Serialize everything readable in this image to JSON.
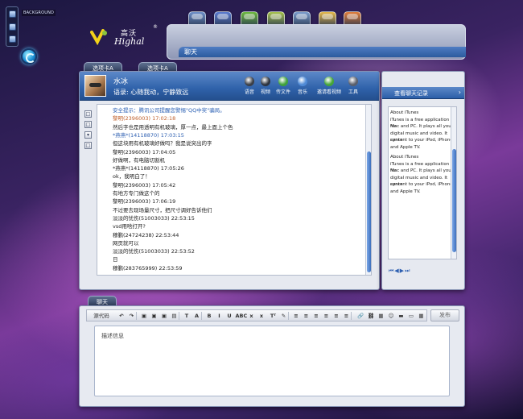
{
  "corner": {
    "background_label": "BACKGROUND"
  },
  "logo": {
    "cn": "高沃",
    "en": "Highal",
    "reg": "®"
  },
  "app_icons": [
    {
      "name": "tools-app-icon",
      "color": "#6d8fc9"
    },
    {
      "name": "users-app-icon",
      "color": "#5a7bd0"
    },
    {
      "name": "butterfly-app-icon",
      "color": "#6cb93e"
    },
    {
      "name": "photo-app-icon",
      "color": "#a6c24d"
    },
    {
      "name": "camera-app-icon",
      "color": "#7a9ccc"
    },
    {
      "name": "document-app-icon",
      "color": "#e5b84a"
    },
    {
      "name": "presentation-app-icon",
      "color": "#e07d3a"
    }
  ],
  "chat_window": {
    "title": "聊天"
  },
  "tabs": [
    "选项卡A",
    "选项卡A"
  ],
  "chat": {
    "user_name": "水冰",
    "signature": "语录: 心随我动，宁静致远",
    "tools": [
      {
        "label": "语音",
        "color": "#3b3f47"
      },
      {
        "label": "视频",
        "color": "#2d3440"
      },
      {
        "label": "传文件",
        "color": "#3fa13c"
      },
      {
        "label": "音乐",
        "color": "#4f8ad6"
      },
      {
        "label": "邀请看视频",
        "color": "#44a537"
      },
      {
        "label": "工具",
        "color": "#5a5f6c"
      }
    ],
    "side_tools": [
      "□",
      "□",
      "▾",
      "□"
    ],
    "messages": [
      {
        "text": "安全提示：腾讯公司提醒您警惕\"QQ中奖\"骗局。",
        "style": "sys"
      },
      {
        "text": "黎明(2396003) 17:02:18",
        "style": "orange"
      },
      {
        "text": "然后字也是用透明有机玻璃，厚一点，最上面上个色",
        "style": "normal"
      },
      {
        "text": "*燕燕*(14118870) 17:03:15",
        "style": "blue"
      },
      {
        "text": "但这块用有机玻璃好做吗？我是说突出的字",
        "style": "normal"
      },
      {
        "text": "黎明(2396003) 17:04:05",
        "style": "normal"
      },
      {
        "text": "好做啊，有电脑切割机",
        "style": "normal"
      },
      {
        "text": "*燕燕*(14118870) 17:05:26",
        "style": "normal"
      },
      {
        "text": "ok，我明白了！",
        "style": "normal"
      },
      {
        "text": "黎明(2396003) 17:05:42",
        "style": "normal"
      },
      {
        "text": "有地方专门做这个的",
        "style": "normal"
      },
      {
        "text": "黎明(2396003) 17:06:19",
        "style": "normal"
      },
      {
        "text": "不过要去现场量尺寸，把尺寸调好告诉他们",
        "style": "normal"
      },
      {
        "text": "淡淡的忧伤(51003033) 22:53:15",
        "style": "normal"
      },
      {
        "text": "vsd用啥打开?",
        "style": "normal"
      },
      {
        "text": "穆鹏(24724238) 22:53:44",
        "style": "normal"
      },
      {
        "text": "网页就可以",
        "style": "normal"
      },
      {
        "text": "淡淡的忧伤(51003033) 22:53:52",
        "style": "normal"
      },
      {
        "text": "日",
        "style": "normal"
      },
      {
        "text": "穆鹏(283765999) 22:53:59",
        "style": "normal"
      }
    ]
  },
  "history": {
    "title": "查看聊天记录",
    "arrow": "›",
    "entries": [
      [
        "About iTunes",
        "iTunes is a free application for",
        "Mac and PC. It plays all your",
        "digital music and video. It syncs",
        " content to your iPod, iPhone,",
        "and Apple TV."
      ],
      [
        "About iTunes",
        "iTunes is a free application for",
        "Mac and PC. It plays all your",
        "digital music and video. It syncs",
        " content to your iPod, iPhone,",
        "and Apple TV."
      ]
    ],
    "pager": "⏮◀▶⏭"
  },
  "composer": {
    "tab_label": "聊天",
    "toolbar": {
      "source_label": "源代码",
      "buttons": [
        "↶",
        "↷",
        "▣",
        "▣",
        "▣",
        "▤",
        "T",
        "A",
        "B",
        "I",
        "U",
        "ABC",
        "x",
        "x",
        "Tᵀ",
        "✎",
        "≡",
        "≡",
        "≡",
        "≡",
        "≡",
        "≡",
        "🔗",
        "⛓",
        "▦",
        "☺",
        "▬",
        "▭",
        "▦"
      ]
    },
    "publish_label": "发布",
    "placeholder": "描述信息"
  }
}
